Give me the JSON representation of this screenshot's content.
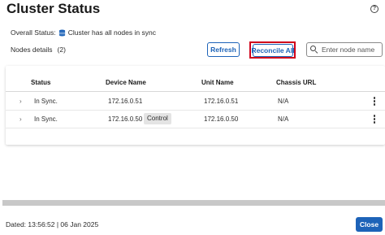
{
  "header": {
    "title": "Cluster Status",
    "help_icon": "?"
  },
  "overall": {
    "label": "Overall Status:",
    "icon": "database-icon",
    "status": "Cluster has all nodes in sync"
  },
  "nodes": {
    "label": "Nodes details",
    "count": "(2)"
  },
  "toolbar": {
    "refresh_label": "Refresh",
    "reconcile_label": "Reconcile All",
    "search_placeholder": "Enter node name"
  },
  "table": {
    "columns": [
      "Status",
      "Device Name",
      "Unit Name",
      "Chassis URL"
    ],
    "rows": [
      {
        "status": "In Sync.",
        "device": "172.16.0.51",
        "badge": "",
        "unit": "172.16.0.51",
        "chassis": "N/A"
      },
      {
        "status": "In Sync.",
        "device": "172.16.0.50",
        "badge": "Control",
        "unit": "172.16.0.50",
        "chassis": "N/A"
      }
    ]
  },
  "footer": {
    "dated": "Dated: 13:56:52 | 06 Jan 2025",
    "close_label": "Close"
  },
  "colors": {
    "accent": "#1d63b8",
    "highlight_border": "#d0021b"
  }
}
